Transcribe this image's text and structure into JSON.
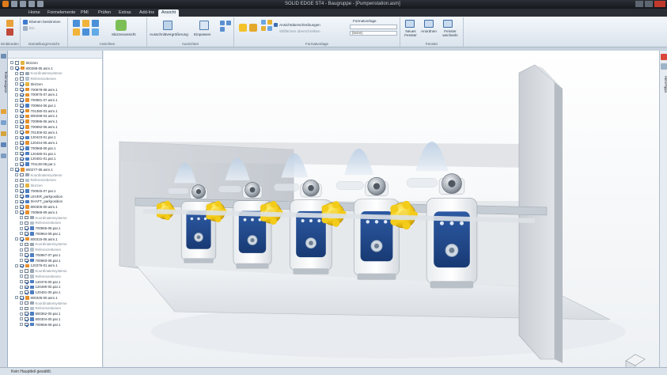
{
  "window": {
    "title": "SOLID EDGE ST4 - Baugruppe - [Pumpenstation.asm]"
  },
  "tabs": [
    {
      "label": "Home"
    },
    {
      "label": "Formelemente"
    },
    {
      "label": "PMI"
    },
    {
      "label": "Prüfen"
    },
    {
      "label": "Extras"
    },
    {
      "label": "Add-Ins"
    },
    {
      "label": "Ansicht"
    }
  ],
  "ribbon": {
    "groups": [
      {
        "label": "Einblenden"
      },
      {
        "label": "Darstellung/Ansicht"
      },
      {
        "label": "Ansichten"
      },
      {
        "label": "Ausrichten"
      },
      {
        "label": "Formatvorlage"
      },
      {
        "label": "Fenster"
      }
    ],
    "buttons": {
      "ebenen": "Ebenen bestimmen",
      "ein": "Ein",
      "skizzenansicht": "Skizzenansicht",
      "ausschnitt": "Ausschnittvergrößerung",
      "einpassen": "Einpassen",
      "ansichtsueberschreibungen": "Ansichtüberschreibungen",
      "stilflaechen": "Stilflächen überschreiben",
      "formatvorlage_label": "Formatvorlage",
      "formatvorlage_value": "",
      "keine": "(keine)",
      "neues_fenster": "Neues Fenster",
      "anordnen": "Anordnen",
      "fenster_wechseln": "Fenster wechseln"
    }
  },
  "left_rail": {
    "vertical_label": "Teilenavigator"
  },
  "right_rail": {
    "vertical_label": "Hilfe/Tipps"
  },
  "tree": {
    "rows": [
      {
        "indent": 0,
        "label": "Skizzen",
        "checked": false,
        "icon": "folder",
        "dim": false
      },
      {
        "indent": 0,
        "label": "800288-05.asm.1",
        "checked": true,
        "icon": "assembly",
        "dim": false
      },
      {
        "indent": 1,
        "label": "Koordinatensysteme",
        "checked": false,
        "icon": "coord",
        "dim": true
      },
      {
        "indent": 1,
        "label": "Referenzebenen",
        "checked": false,
        "icon": "plane",
        "dim": true
      },
      {
        "indent": 1,
        "label": "Skizzen",
        "checked": true,
        "icon": "folder",
        "dim": false
      },
      {
        "indent": 1,
        "label": "700978-08.asm.1",
        "checked": true,
        "icon": "assembly",
        "dim": false
      },
      {
        "indent": 1,
        "label": "700975-07.asm.1",
        "checked": true,
        "icon": "assembly",
        "dim": false
      },
      {
        "indent": 1,
        "label": "700981-07.asm.1",
        "checked": true,
        "icon": "assembly",
        "dim": false
      },
      {
        "indent": 1,
        "label": "700984-06.par.1",
        "checked": true,
        "icon": "part",
        "dim": false
      },
      {
        "indent": 1,
        "label": "701380-03.asm.1",
        "checked": true,
        "icon": "assembly",
        "dim": false
      },
      {
        "indent": 1,
        "label": "800298-04.asm.1",
        "checked": true,
        "icon": "assembly",
        "dim": false
      },
      {
        "indent": 1,
        "label": "700995-06.asm.1",
        "checked": true,
        "icon": "assembly",
        "dim": false
      },
      {
        "indent": 1,
        "label": "700992-06.asm.1",
        "checked": true,
        "icon": "assembly",
        "dim": false
      },
      {
        "indent": 1,
        "label": "701306-02.asm.1",
        "checked": true,
        "icon": "assembly",
        "dim": false
      },
      {
        "indent": 1,
        "label": "120423-01.par.1",
        "checked": true,
        "icon": "part",
        "dim": false
      },
      {
        "indent": 1,
        "label": "120444-05.asm.1",
        "checked": true,
        "icon": "assembly",
        "dim": false
      },
      {
        "indent": 1,
        "label": "700968-09.par.1",
        "checked": true,
        "icon": "part",
        "dim": false
      },
      {
        "indent": 1,
        "label": "120480-01.par.1",
        "checked": true,
        "icon": "part",
        "dim": false
      },
      {
        "indent": 1,
        "label": "120481-01.par.1",
        "checked": true,
        "icon": "part",
        "dim": false
      },
      {
        "indent": 1,
        "label": "701128-08.par.1",
        "checked": true,
        "icon": "part",
        "dim": false
      },
      {
        "indent": 0,
        "label": "800277-05.asm.1",
        "checked": true,
        "icon": "assembly",
        "dim": false
      },
      {
        "indent": 1,
        "label": "Koordinatensysteme",
        "checked": false,
        "icon": "coord",
        "dim": true
      },
      {
        "indent": 1,
        "label": "Referenzebenen",
        "checked": false,
        "icon": "plane",
        "dim": true
      },
      {
        "indent": 1,
        "label": "Skizzen",
        "checked": false,
        "icon": "folder",
        "dim": true
      },
      {
        "indent": 1,
        "label": "700945-07.par.1",
        "checked": true,
        "icon": "part",
        "dim": false
      },
      {
        "indent": 1,
        "label": "LEVER_parkposition",
        "checked": true,
        "icon": "part",
        "dim": false
      },
      {
        "indent": 1,
        "label": "SHAFT_parkposition",
        "checked": true,
        "icon": "part",
        "dim": false
      },
      {
        "indent": 1,
        "label": "800305-00.asm.1",
        "checked": true,
        "icon": "assembly",
        "dim": false
      },
      {
        "indent": 1,
        "label": "700969-09.asm.1",
        "checked": true,
        "icon": "assembly",
        "dim": false
      },
      {
        "indent": 2,
        "label": "Koordinatensysteme",
        "checked": false,
        "icon": "coord",
        "dim": true
      },
      {
        "indent": 2,
        "label": "Referenzebenen",
        "checked": false,
        "icon": "plane",
        "dim": true
      },
      {
        "indent": 2,
        "label": "700965-08.par.1",
        "checked": true,
        "icon": "part",
        "dim": false
      },
      {
        "indent": 2,
        "label": "700964-09.par.1",
        "checked": true,
        "icon": "part",
        "dim": false
      },
      {
        "indent": 1,
        "label": "800315-06.asm.1",
        "checked": true,
        "icon": "assembly",
        "dim": false
      },
      {
        "indent": 2,
        "label": "Koordinatensysteme",
        "checked": false,
        "icon": "coord",
        "dim": true
      },
      {
        "indent": 2,
        "label": "Referenzebenen",
        "checked": false,
        "icon": "plane",
        "dim": true
      },
      {
        "indent": 2,
        "label": "700967-07.par.1",
        "checked": true,
        "icon": "part",
        "dim": false
      },
      {
        "indent": 2,
        "label": "700983-08.par.1",
        "checked": true,
        "icon": "part",
        "dim": false
      },
      {
        "indent": 1,
        "label": "120376-01.asm.1",
        "checked": true,
        "icon": "assembly",
        "dim": false
      },
      {
        "indent": 2,
        "label": "Koordinatensysteme",
        "checked": false,
        "icon": "coord",
        "dim": true
      },
      {
        "indent": 2,
        "label": "Referenzebenen",
        "checked": false,
        "icon": "plane",
        "dim": true
      },
      {
        "indent": 2,
        "label": "120376-00.par.1",
        "checked": true,
        "icon": "part",
        "dim": false
      },
      {
        "indent": 2,
        "label": "120490-00.par.1",
        "checked": true,
        "icon": "part",
        "dim": false
      },
      {
        "indent": 2,
        "label": "120491-00.par.1",
        "checked": true,
        "icon": "part",
        "dim": false
      },
      {
        "indent": 1,
        "label": "800335-00.asm.1",
        "checked": true,
        "icon": "assembly",
        "dim": false
      },
      {
        "indent": 2,
        "label": "Koordinatensysteme",
        "checked": false,
        "icon": "coord",
        "dim": true
      },
      {
        "indent": 2,
        "label": "Referenzebenen",
        "checked": false,
        "icon": "plane",
        "dim": true
      },
      {
        "indent": 2,
        "label": "800362-00.par.1",
        "checked": true,
        "icon": "part",
        "dim": false
      },
      {
        "indent": 2,
        "label": "800304-00.par.1",
        "checked": true,
        "icon": "part",
        "dim": false
      },
      {
        "indent": 2,
        "label": "700956-09.par.1",
        "checked": true,
        "icon": "part",
        "dim": false
      }
    ]
  },
  "status": {
    "text": "Kein Hauptteil gewählt."
  },
  "colors": {
    "frame": "#1b1f24",
    "accent": "#e07b1a",
    "pump_blue": "#1f4a8f",
    "knob_yellow": "#f3cb19"
  }
}
